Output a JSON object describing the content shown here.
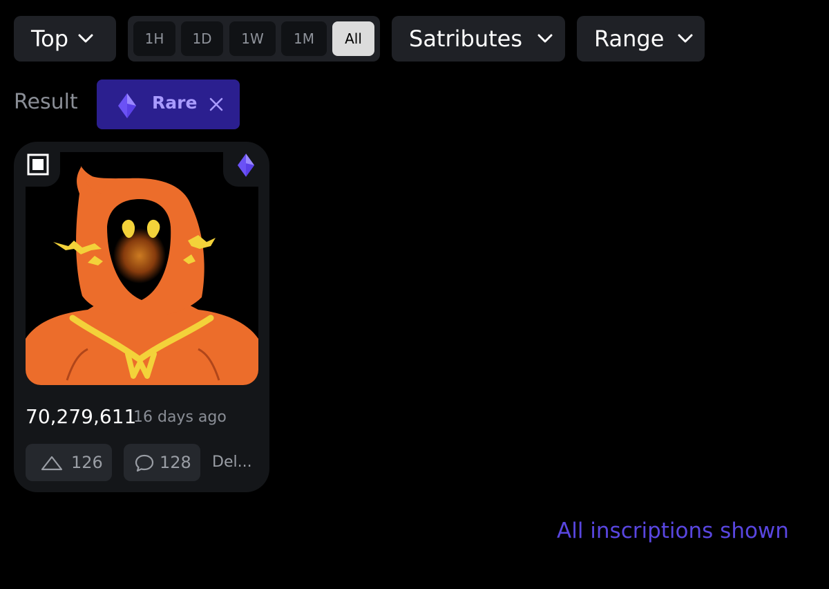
{
  "filters": {
    "sort": {
      "label": "Top"
    },
    "time_ranges": [
      {
        "label": "1H",
        "active": false
      },
      {
        "label": "1D",
        "active": false
      },
      {
        "label": "1W",
        "active": false
      },
      {
        "label": "1M",
        "active": false
      },
      {
        "label": "All",
        "active": true
      }
    ],
    "satributes": {
      "label": "Satributes"
    },
    "range": {
      "label": "Range"
    }
  },
  "result": {
    "label": "Result",
    "chip": {
      "label": "Rare",
      "icon": "diamond-icon",
      "color": "#2b1f8f"
    }
  },
  "card": {
    "number": "70,279,611",
    "time": "16 days ago",
    "upvotes": "126",
    "comments": "128",
    "owner": "Del...",
    "rarity_icon": "diamond-icon",
    "select_icon": "checkbox-icon"
  },
  "footer": {
    "message": "All inscriptions shown"
  },
  "colors": {
    "accent": "#5946e0",
    "diamond": "#7a62ff",
    "button_bg": "#1f2126"
  }
}
